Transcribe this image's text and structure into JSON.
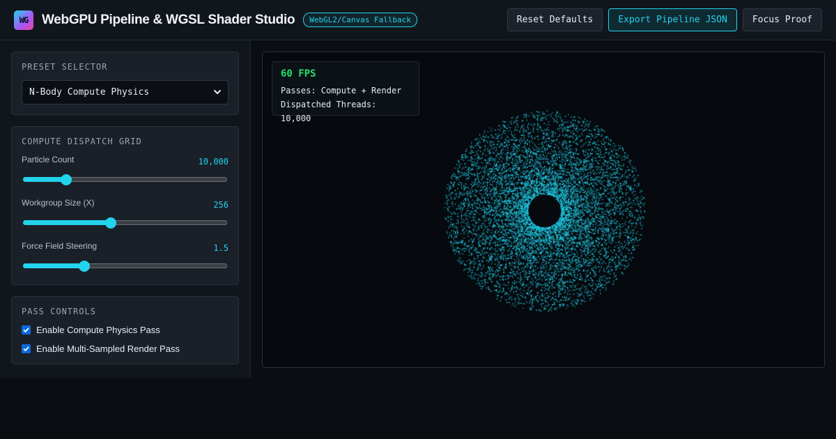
{
  "header": {
    "logo_text": "WG",
    "title": "WebGPU Pipeline & WGSL Shader Studio",
    "badge": "WebGL2/Canvas Fallback",
    "actions": {
      "reset": "Reset Defaults",
      "export": "Export Pipeline JSON",
      "focus": "Focus Proof"
    }
  },
  "sidebar": {
    "preset": {
      "title": "PRESET SELECTOR",
      "selected": "N-Body Compute Physics"
    },
    "dispatch": {
      "title": "COMPUTE DISPATCH GRID",
      "sliders": [
        {
          "label": "Particle Count",
          "value": "10,000",
          "fraction": 0.21
        },
        {
          "label": "Workgroup Size (X)",
          "value": "256",
          "fraction": 0.43
        },
        {
          "label": "Force Field Steering",
          "value": "1.5",
          "fraction": 0.3
        }
      ]
    },
    "passes": {
      "title": "PASS CONTROLS",
      "items": [
        {
          "label": "Enable Compute Physics Pass",
          "checked": true
        },
        {
          "label": "Enable Multi-Sampled Render Pass",
          "checked": true
        }
      ]
    }
  },
  "viewport": {
    "fps": "60 FPS",
    "passes": "Passes: Compute + Render",
    "threads": "Dispatched Threads: 10,000"
  },
  "colors": {
    "accent": "#22d3ee",
    "fps_green": "#22e06b",
    "checkbox_blue": "#0b6bde"
  }
}
